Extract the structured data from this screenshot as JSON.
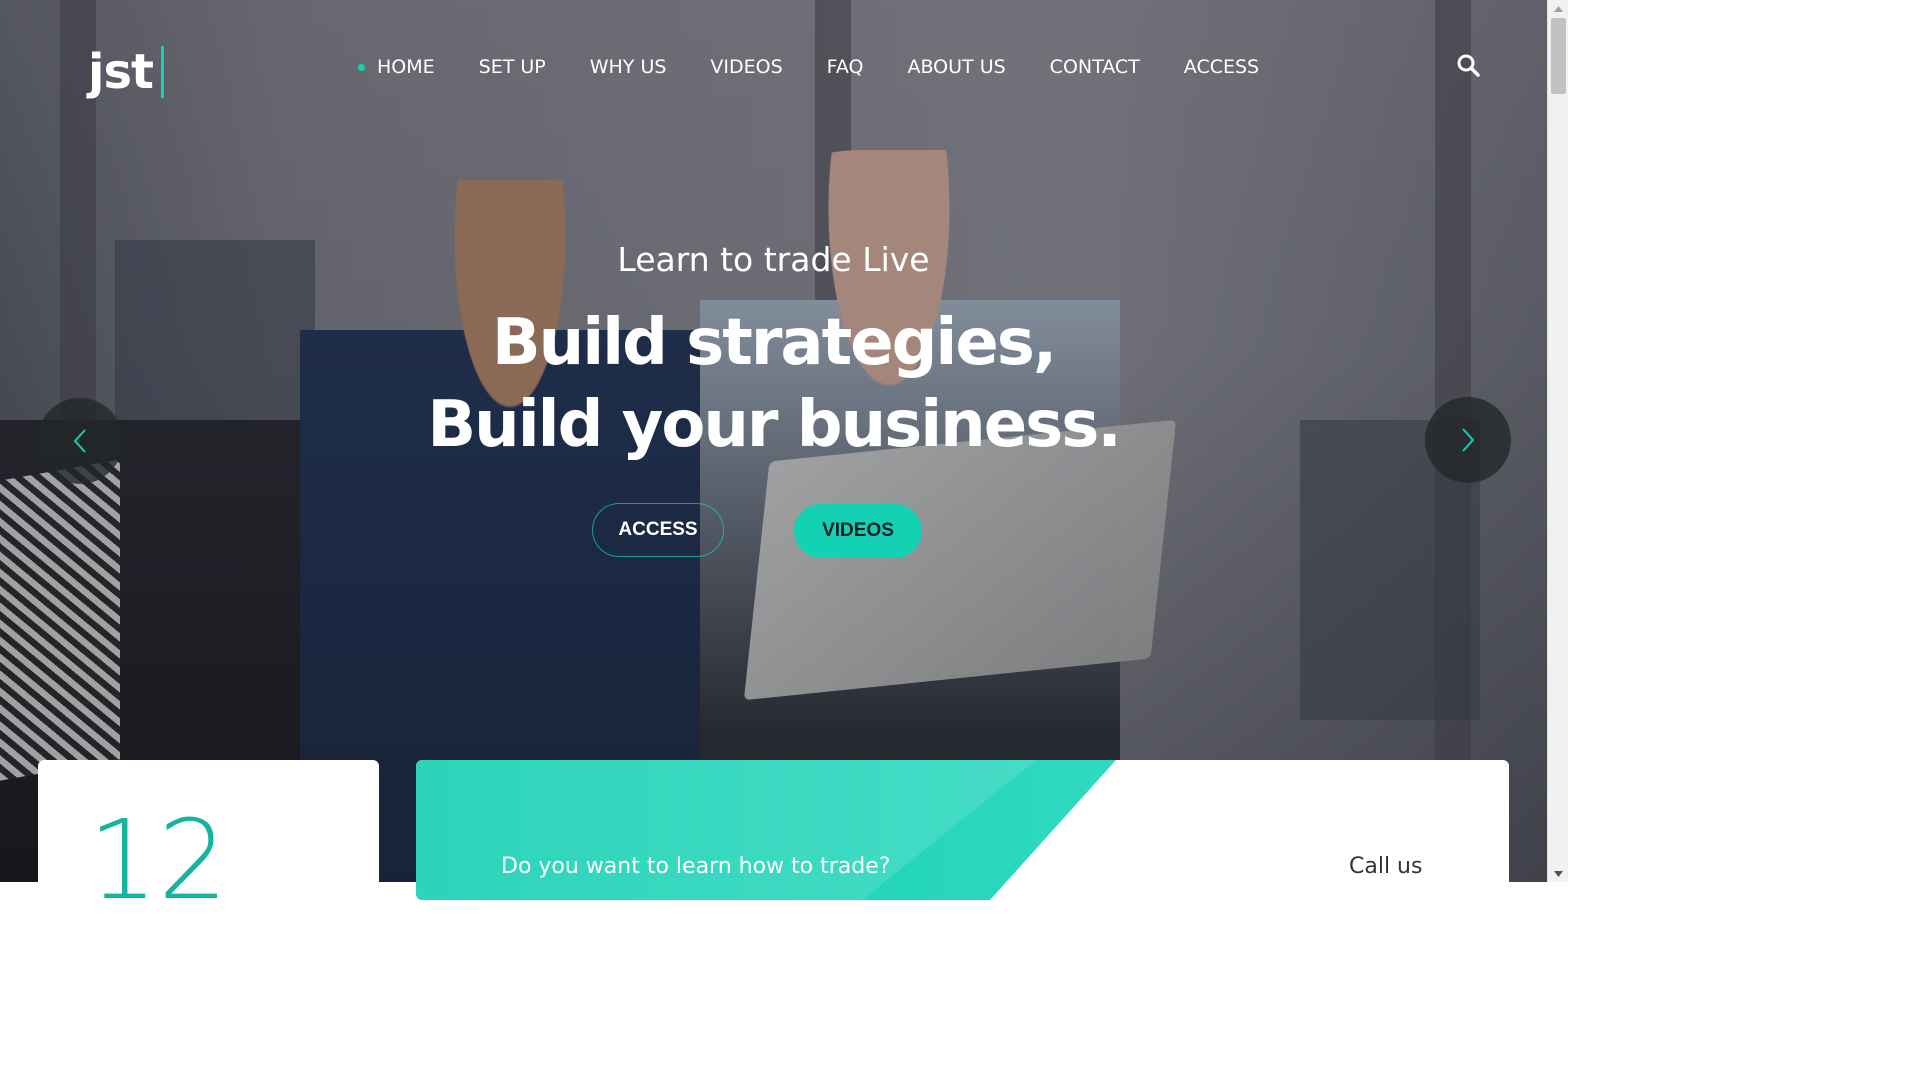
{
  "logo": {
    "text": "jst"
  },
  "nav": {
    "items": [
      {
        "label": "HOME",
        "active": true
      },
      {
        "label": "SET UP"
      },
      {
        "label": "WHY US"
      },
      {
        "label": "VIDEOS"
      },
      {
        "label": "FAQ"
      },
      {
        "label": "ABOUT US"
      },
      {
        "label": "CONTACT"
      },
      {
        "label": "ACCESS"
      }
    ],
    "search_icon": "search-icon"
  },
  "hero": {
    "subtitle": "Learn to trade Live",
    "title_line1": "Build strategies,",
    "title_line2": "Build your business.",
    "button_access": "ACCESS",
    "button_videos": "VIDEOS",
    "prev_icon": "chevron-left-icon",
    "next_icon": "chevron-right-icon"
  },
  "counter_card": {
    "value": "12"
  },
  "cta_card": {
    "question": "Do you want to learn how to trade?",
    "call_label": "Call us"
  },
  "colors": {
    "accent": "#13d1b2",
    "text_light": "#ffffff",
    "arrow_bg": "#222628"
  }
}
